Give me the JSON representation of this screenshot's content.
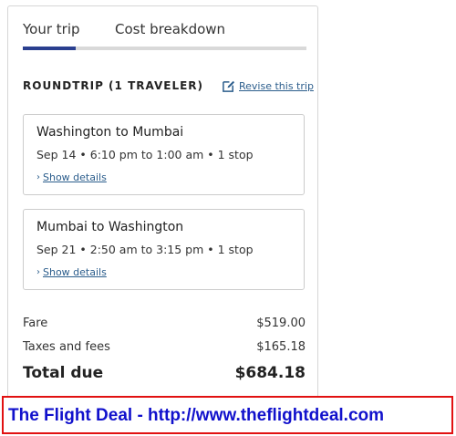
{
  "tabs": [
    {
      "label": "Your trip",
      "active": true
    },
    {
      "label": "Cost breakdown",
      "active": false
    }
  ],
  "trip": {
    "heading": "ROUNDTRIP (1 TRAVELER)",
    "revise_label": "Revise this trip",
    "revise_icon": "edit-icon"
  },
  "legs": [
    {
      "title": "Washington to Mumbai",
      "info": "Sep 14 • 6:10 pm to 1:00 am • 1 stop",
      "link": "Show details"
    },
    {
      "title": "Mumbai to Washington",
      "info": "Sep 21 • 2:50 am to 3:15 pm • 1 stop",
      "link": "Show details"
    }
  ],
  "costs": {
    "fare_label": "Fare",
    "fare_value": "$519.00",
    "taxes_label": "Taxes and fees",
    "taxes_value": "$165.18",
    "total_label": "Total due",
    "total_value": "$684.18"
  },
  "banner": {
    "text": "The Flight Deal - http://www.theflightdeal.com"
  },
  "colors": {
    "accent": "#2a3f8f",
    "link": "#2b5d8c",
    "banner_border": "#e11111",
    "banner_text": "#1111cc"
  }
}
